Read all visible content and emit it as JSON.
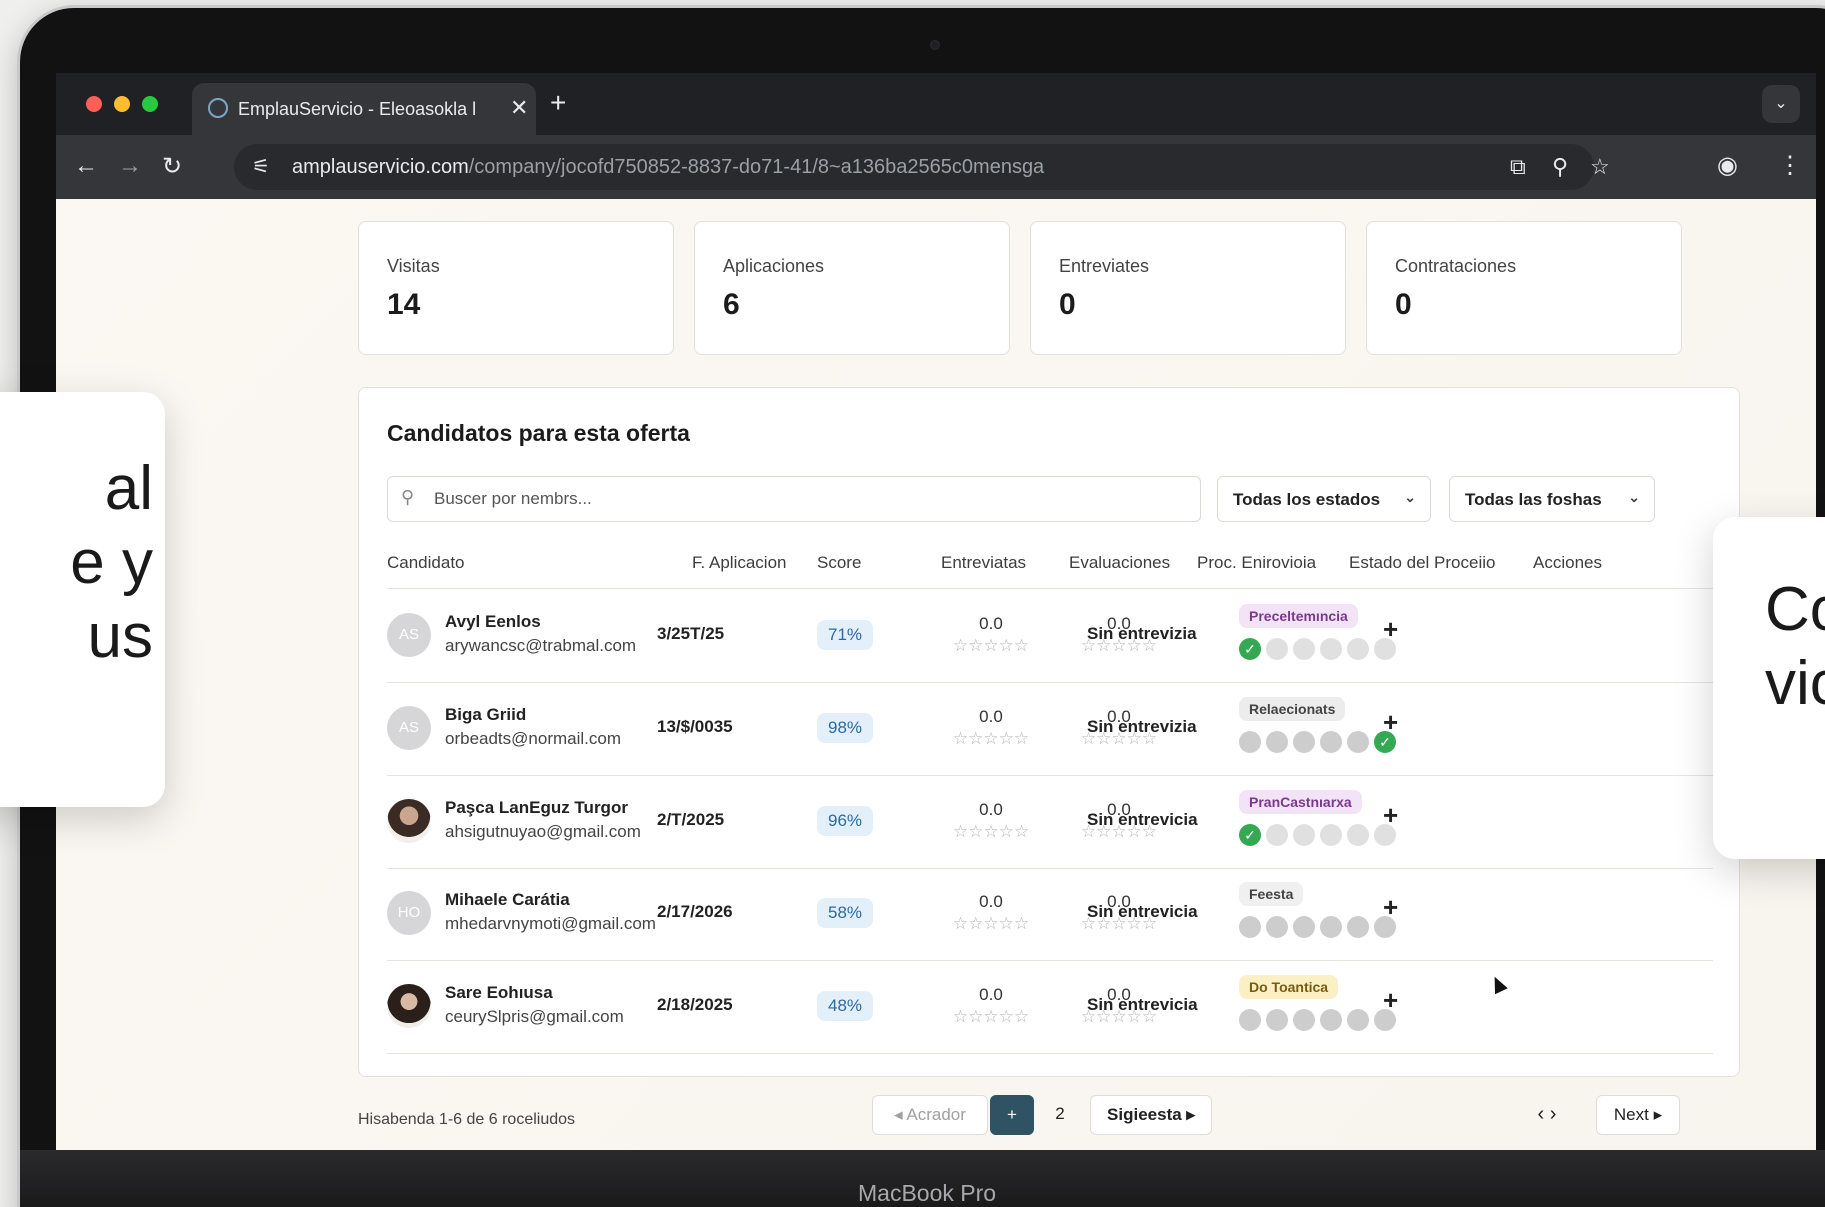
{
  "device": {
    "label": "MacBook Pro"
  },
  "side_cards": {
    "left_text": "al\ne y\nus",
    "right_text": "Co\nvic"
  },
  "browser": {
    "tab_title": "EmplauServicio - Eleoasokla l",
    "close_glyph": "✕",
    "new_tab_glyph": "+",
    "url_host": "amplauservicio.com",
    "url_path": "/company/jocofd750852-8837-do71-41/8~a136ba2565c0mensga"
  },
  "stats": [
    {
      "label": "Visitas",
      "value": "14"
    },
    {
      "label": "Aplicaciones",
      "value": "6"
    },
    {
      "label": "Entreviates",
      "value": "0"
    },
    {
      "label": "Contrataciones",
      "value": "0"
    }
  ],
  "panel": {
    "title": "Candidatos para esta oferta",
    "search_placeholder": "Buscer por nembrs...",
    "filter_status": "Todas los estados",
    "filter_date": "Todas las foshas"
  },
  "columns": {
    "candidate": "Candidato",
    "date": "F. Aplicacion",
    "score": "Score",
    "interviews": "Entreviatas",
    "evaluations": "Evaluaciones",
    "proc": "Proc. Enirovioia",
    "status": "Estado del Proceiio",
    "actions": "Acciones"
  },
  "candidates": [
    {
      "initials": "AS",
      "name": "Avyl Eenlos",
      "email": "arywancsc@trabmal.com",
      "date": "3/25T/25",
      "score": "71%",
      "interview_rating": "0.0",
      "eval_rating": "0.0",
      "proc": "Sin entrevizia",
      "status": "Preceltemıncia",
      "stars": "☆☆☆☆☆",
      "action": "+",
      "status_color": "#f3e3f7",
      "status_text_color": "#7a3a8a"
    },
    {
      "initials": "AS",
      "name": "Biga Griid",
      "email": "orbeadts@normail.com",
      "date": "13/$/0035",
      "score": "98%",
      "interview_rating": "0.0",
      "eval_rating": "0.0",
      "proc": "Sin entrevizia",
      "status": "Relaecionats",
      "stars": "☆☆☆☆☆",
      "action": "+",
      "status_color": "#ececec",
      "status_text_color": "#444444"
    },
    {
      "initials": "",
      "name": "Paşca LanEguz Turgor",
      "email": "ahsigutnuyao@gmail.com",
      "date": "2/T/2025",
      "score": "96%",
      "interview_rating": "0.0",
      "eval_rating": "0.0",
      "proc": "Sin entrevicia",
      "status": "PranCastnıarxa",
      "stars": "☆☆☆☆☆",
      "action": "+",
      "status_color": "#f3e3f7",
      "status_text_color": "#7a3a8a"
    },
    {
      "initials": "HO",
      "name": "Mihaele Carátia",
      "email": "mhedarvnymoti@gmail.com",
      "date": "2/17/2026",
      "score": "58%",
      "interview_rating": "0.0",
      "eval_rating": "0.0",
      "proc": "Sin entrevicia",
      "status": "Feesta",
      "stars": "☆☆☆☆☆",
      "action": "+",
      "status_color": "#f0f0f0",
      "status_text_color": "#444444"
    },
    {
      "initials": "",
      "name": "Sare Eohıusa",
      "email": "ceurySlpris@gmail.com",
      "date": "2/18/2025",
      "score": "48%",
      "interview_rating": "0.0",
      "eval_rating": "0.0",
      "proc": "Sin entrevicia",
      "status": "Do Toantica",
      "stars": "☆☆☆☆☆",
      "action": "+",
      "status_color": "#fbf0c4",
      "status_text_color": "#7a5a10"
    }
  ],
  "pagination": {
    "summary": "Hisabenda 1-6 de 6 roceliudos",
    "prev": "Acrador",
    "current": "+",
    "page2": "2",
    "next_es": "Sigieesta",
    "next_en": "Next"
  }
}
